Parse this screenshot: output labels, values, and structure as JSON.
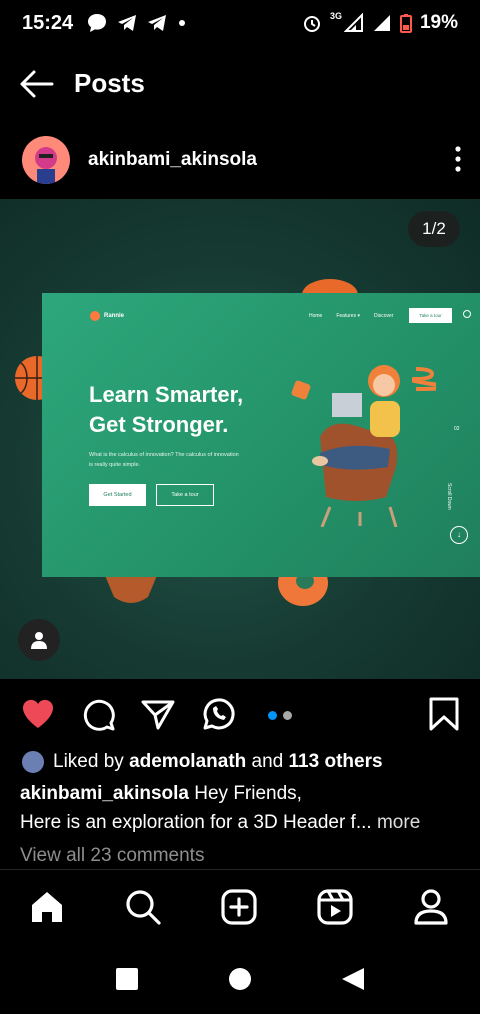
{
  "status_bar": {
    "time": "15:24",
    "network": "3G",
    "battery": "19%",
    "icons": [
      "chat-icon",
      "telegram-icon",
      "telegram-icon",
      "dot-icon",
      "alarm-icon",
      "signal-icon",
      "signal-icon",
      "battery-low-icon"
    ]
  },
  "header": {
    "title": "Posts",
    "back_icon": "arrow-left-icon"
  },
  "post": {
    "username": "akinbami_akinsola",
    "more_icon": "more-vertical-icon",
    "page_indicator": "1/2",
    "mockup": {
      "brand": "Rannie",
      "nav": [
        "Home",
        "Features ▾",
        "Discover"
      ],
      "cta": "Take a tour",
      "headline_line1": "Learn Smarter,",
      "headline_line2": "Get Stronger.",
      "subtext": "What is the calculus of innovation? The calculus of innovation is really quite simple.",
      "button_primary": "Get Started",
      "button_secondary": "Take a tour",
      "scroll_label": "Scroll Down",
      "slide_counter": "02"
    }
  },
  "actions": {
    "icons": [
      "heart-icon",
      "comment-icon",
      "share-icon",
      "whatsapp-icon",
      "bookmark-icon"
    ],
    "colors": {
      "heart": "#ed4956",
      "dot_active": "#0095f6",
      "dot_inactive": "#a8a8a8"
    }
  },
  "likes": {
    "prefix": "Liked by",
    "user": "ademolanath",
    "middle": "and",
    "others": "113 others"
  },
  "caption": {
    "username": "akinbami_akinsola",
    "text_line1": "Hey Friends,",
    "text_line2": "Here is an exploration for a 3D Header f...",
    "more": "more"
  },
  "comments": {
    "label": "View all 23 comments"
  },
  "bottom_nav": [
    "home-icon",
    "search-icon",
    "create-icon",
    "reels-icon",
    "profile-icon"
  ],
  "system_nav": [
    "recents-icon",
    "home-circle-icon",
    "back-triangle-icon"
  ]
}
